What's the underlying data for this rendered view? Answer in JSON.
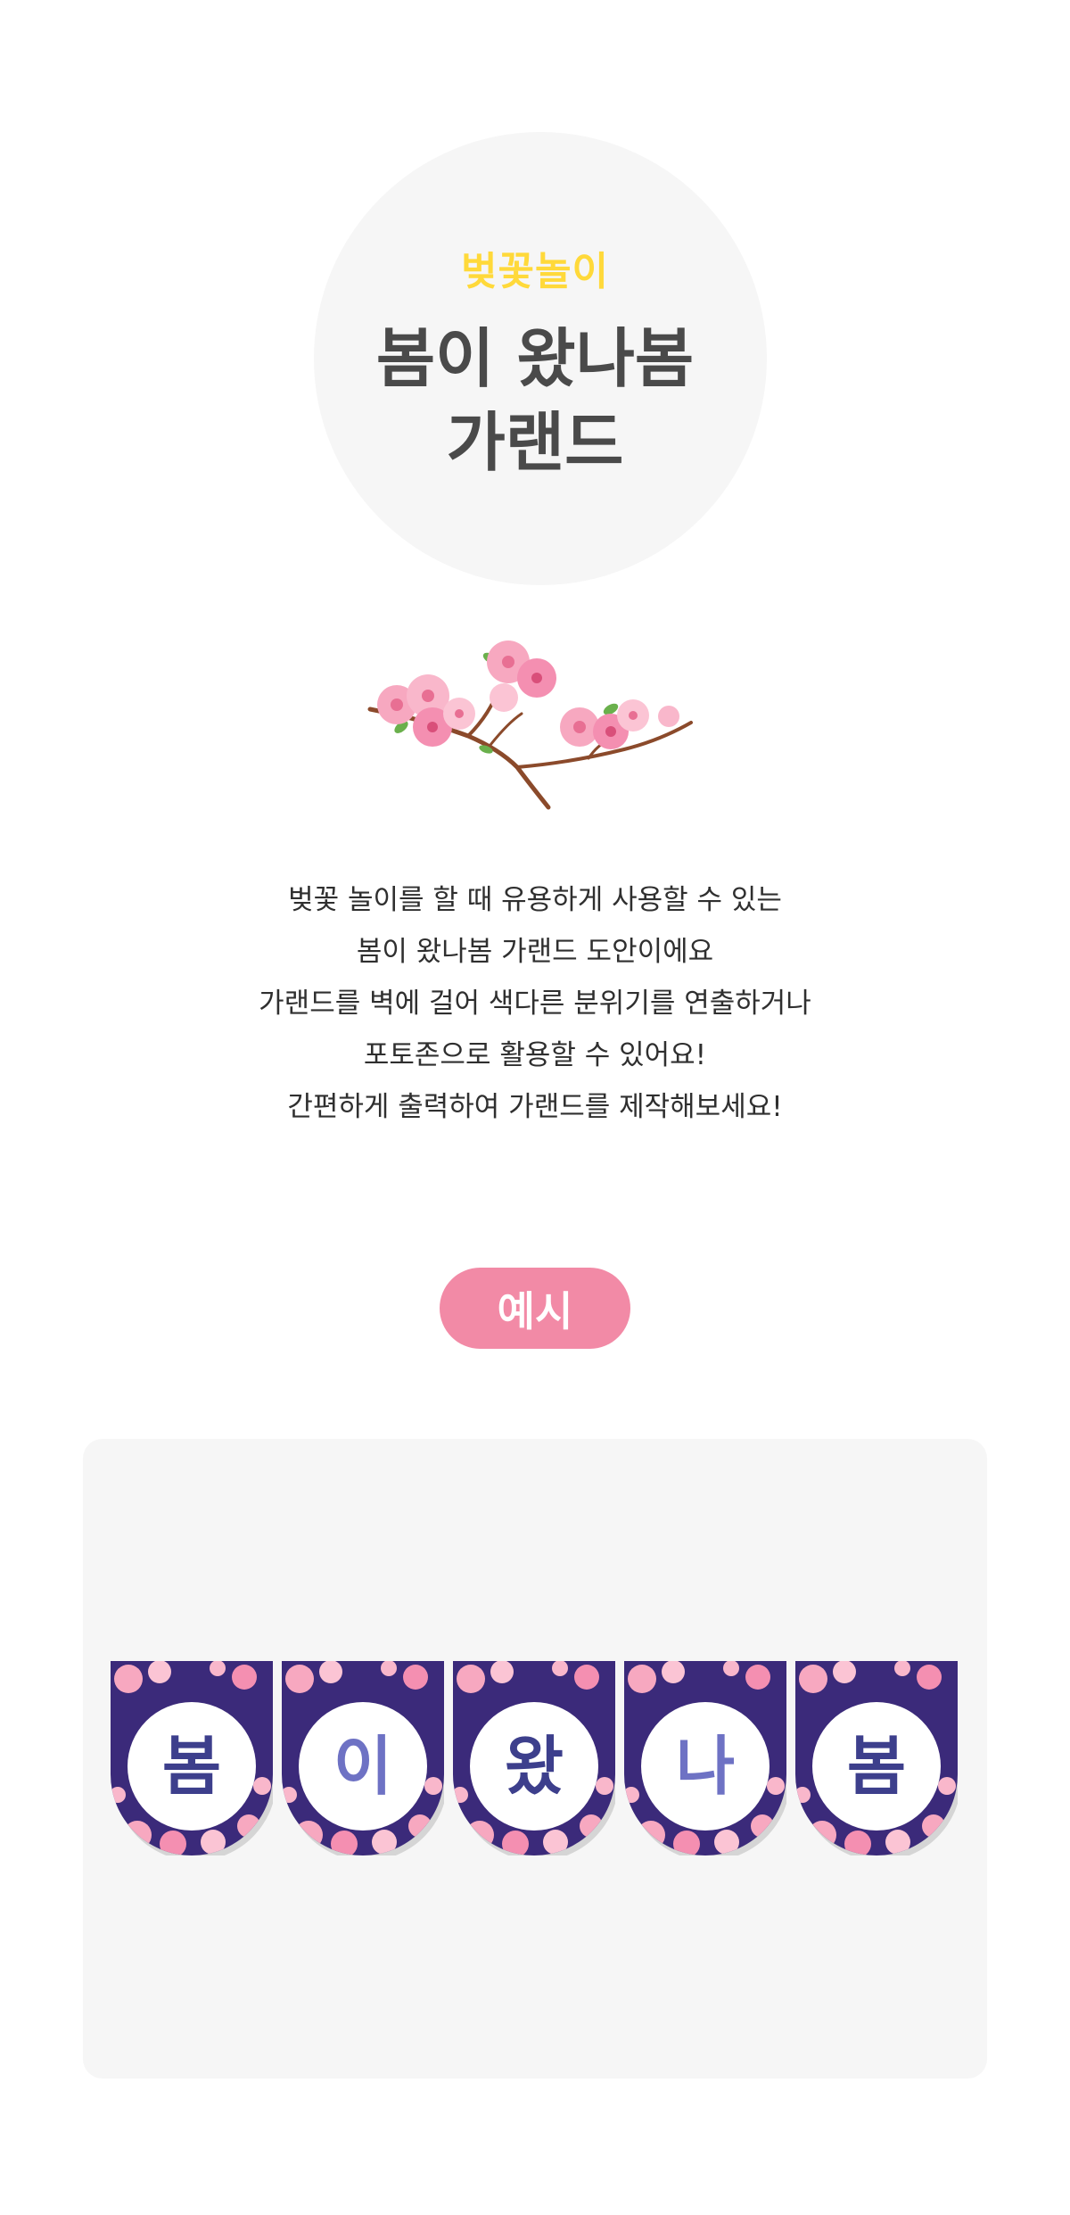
{
  "hero": {
    "subtitle": "벚꽃놀이",
    "title_line1": "봄이 왔나봄",
    "title_line2": "가랜드"
  },
  "description": [
    "벚꽃 놀이를 할 때 유용하게 사용할 수 있는",
    "봄이 왔나봄 가랜드 도안이에요",
    "가랜드를 벽에 걸어 색다른 분위기를 연출하거나",
    "포토존으로 활용할 수 있어요!",
    "간편하게 출력하여 가랜드를 제작해보세요!"
  ],
  "example": {
    "badge_label": "예시",
    "pennants": [
      {
        "letter": "봄",
        "color": "#3d3f8c"
      },
      {
        "letter": "이",
        "color": "#6e72c4"
      },
      {
        "letter": "왔",
        "color": "#3d3f8c"
      },
      {
        "letter": "나",
        "color": "#6e72c4"
      },
      {
        "letter": "봄",
        "color": "#3d3f8c"
      }
    ]
  },
  "colors": {
    "accent_yellow": "#ffd93a",
    "badge_pink": "#f28aa6",
    "pennant_purple": "#3b2a7a",
    "blossom_pink": "#f7a8c0"
  }
}
